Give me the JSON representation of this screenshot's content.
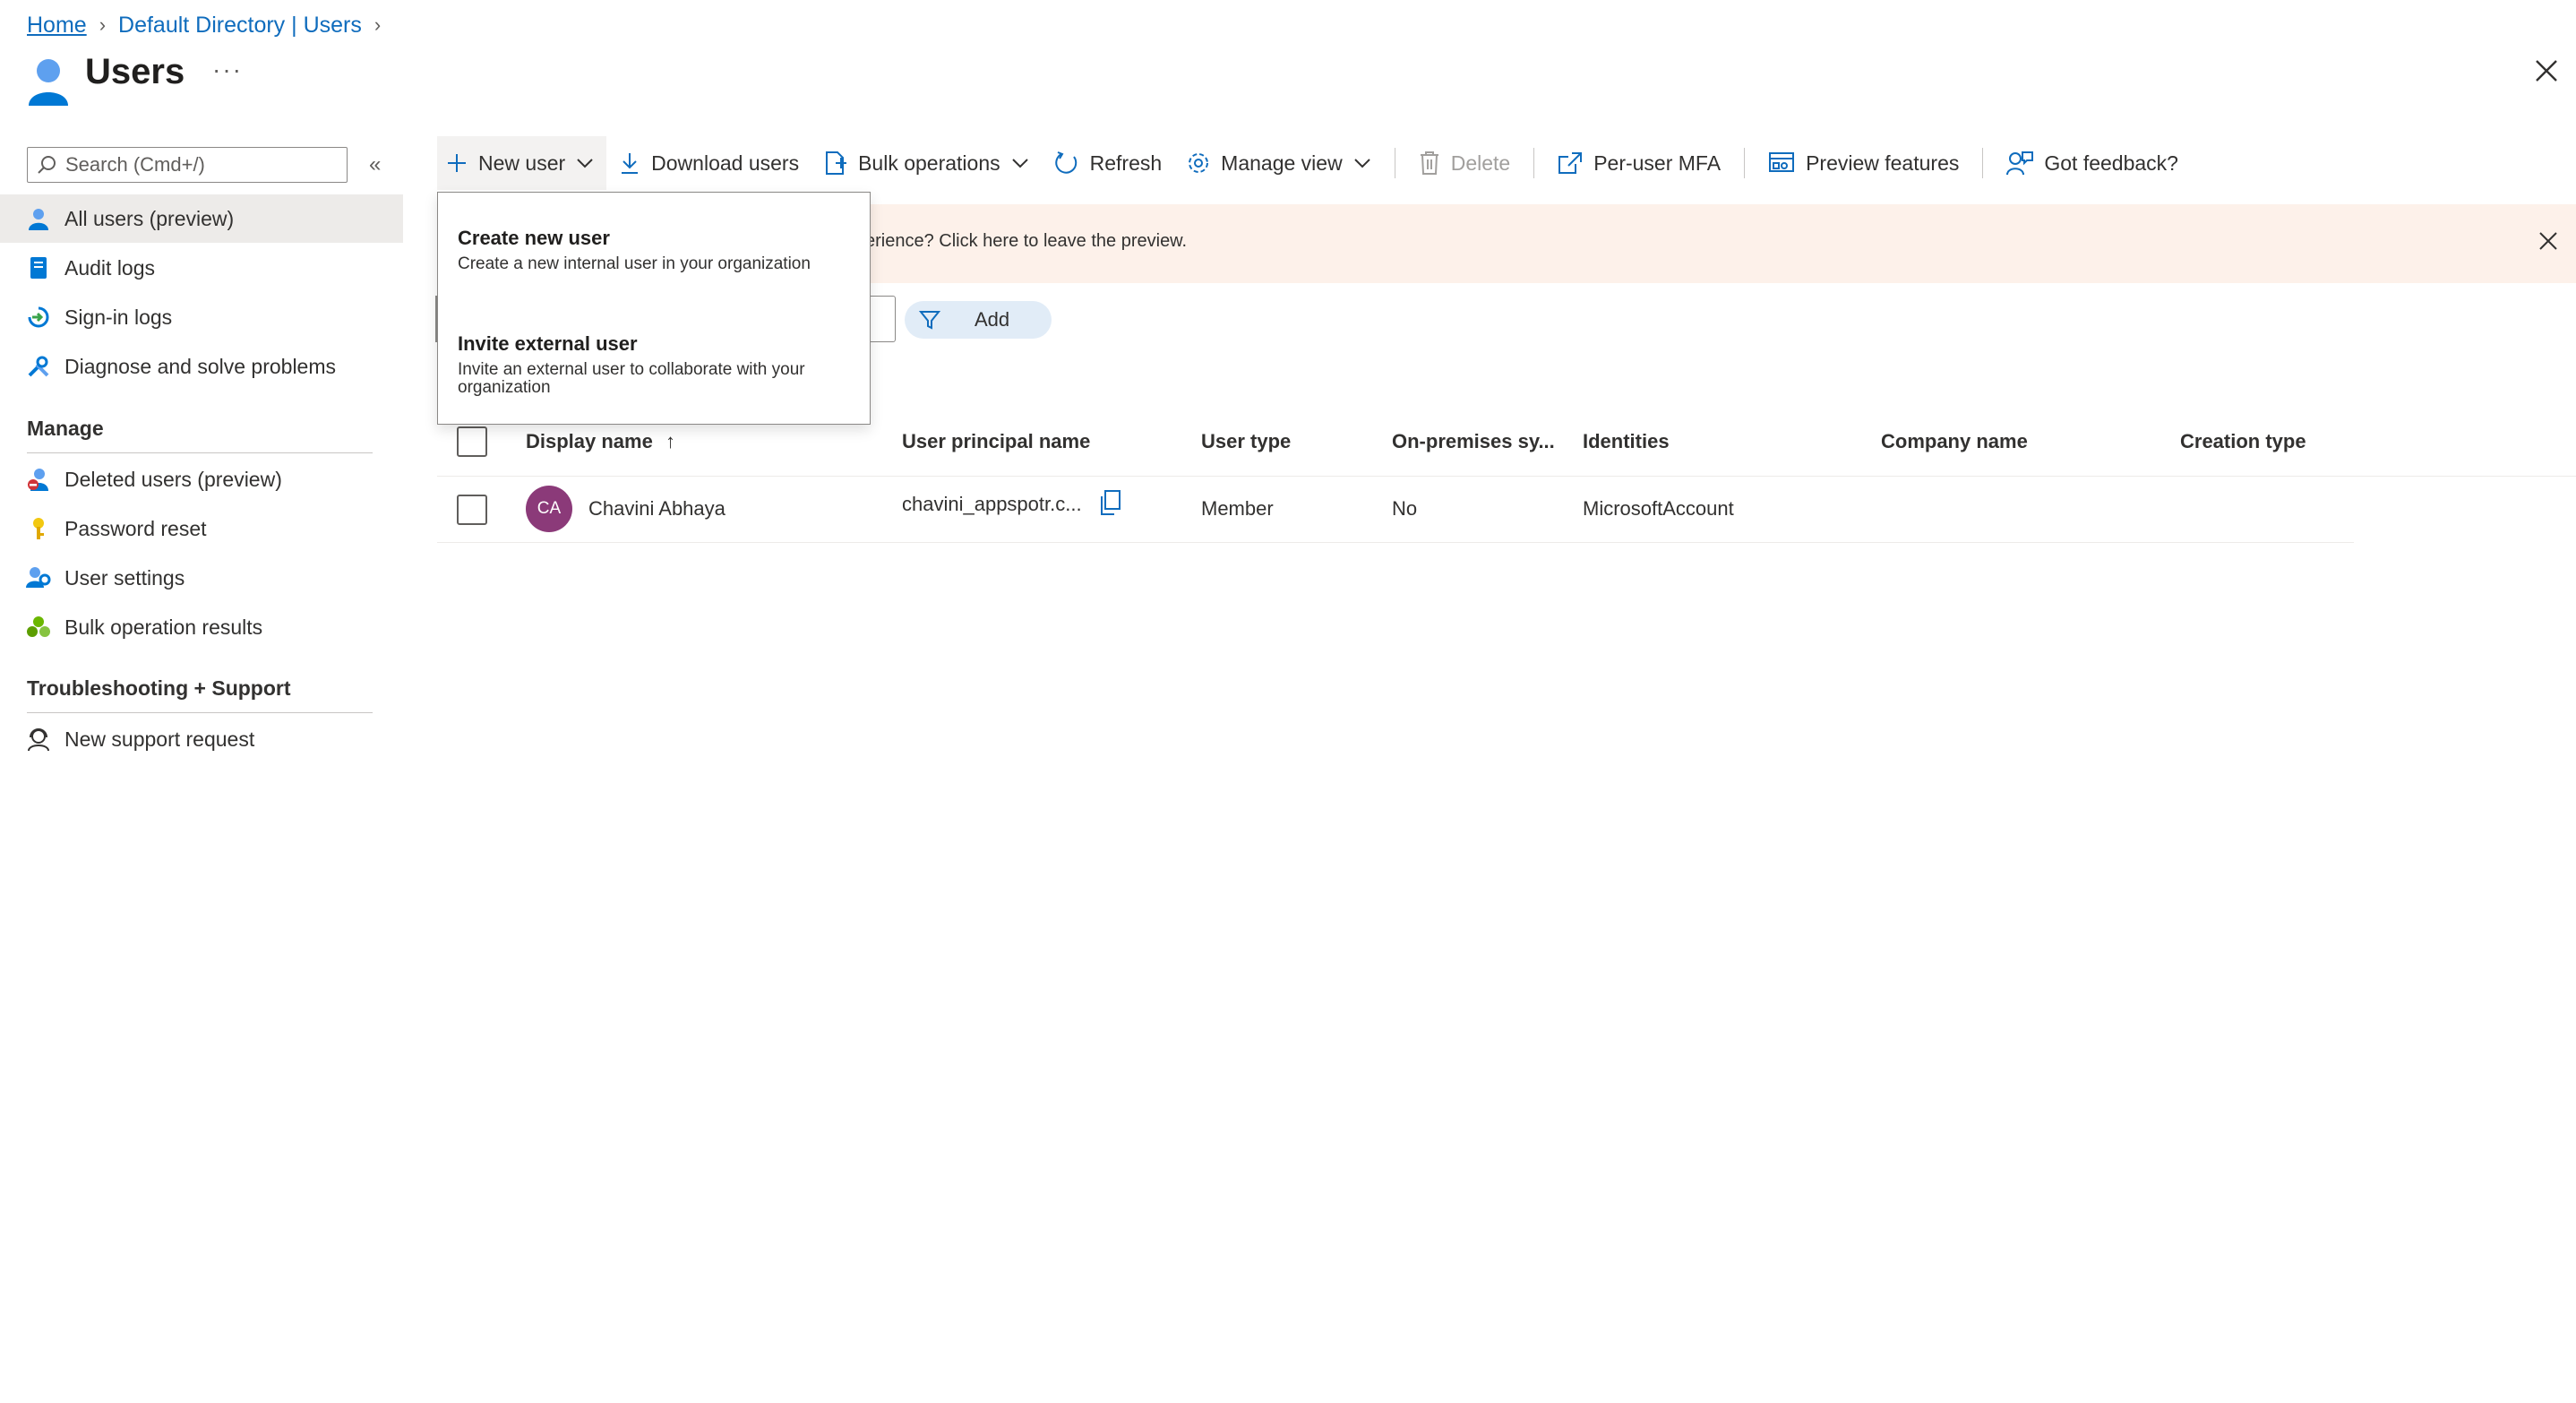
{
  "breadcrumb": {
    "home": "Home",
    "directory": "Default Directory | Users"
  },
  "header": {
    "title": "Users",
    "more": "···"
  },
  "sidebar": {
    "search_placeholder": "Search (Cmd+/)",
    "collapse": "«",
    "items": [
      {
        "label": "All users (preview)",
        "icon": "user-icon",
        "active": true
      },
      {
        "label": "Audit logs",
        "icon": "audit-log-icon"
      },
      {
        "label": "Sign-in logs",
        "icon": "sign-in-icon"
      },
      {
        "label": "Diagnose and solve problems",
        "icon": "wrench-icon"
      }
    ],
    "manage_heading": "Manage",
    "manage_items": [
      {
        "label": "Deleted users (preview)",
        "icon": "deleted-user-icon"
      },
      {
        "label": "Password reset",
        "icon": "key-icon"
      },
      {
        "label": "User settings",
        "icon": "user-settings-icon"
      },
      {
        "label": "Bulk operation results",
        "icon": "bulk-results-icon"
      }
    ],
    "support_heading": "Troubleshooting + Support",
    "support_items": [
      {
        "label": "New support request",
        "icon": "support-icon"
      }
    ]
  },
  "toolbar": {
    "new_user": "New user",
    "download_users": "Download users",
    "bulk_operations": "Bulk operations",
    "refresh": "Refresh",
    "manage_view": "Manage view",
    "delete": "Delete",
    "per_user_mfa": "Per-user MFA",
    "preview_features": "Preview features",
    "got_feedback": "Got feedback?"
  },
  "banner": {
    "text": "erience? Click here to leave the preview."
  },
  "filter": {
    "add_label": "Add"
  },
  "dropdown": {
    "create_title": "Create new user",
    "create_desc": "Create a new internal user in your organization",
    "invite_title": "Invite external user",
    "invite_desc": "Invite an external user to collaborate with your organization"
  },
  "table": {
    "columns": [
      "Display name",
      "User principal name",
      "User type",
      "On-premises sy...",
      "Identities",
      "Company name",
      "Creation type"
    ],
    "sort_indicator": "↑",
    "rows": [
      {
        "initials": "CA",
        "display_name": "Chavini Abhaya",
        "upn": "chavini_appspotr.c...",
        "user_type": "Member",
        "on_prem": "No",
        "identities": "MicrosoftAccount",
        "company": "",
        "creation_type": ""
      }
    ]
  },
  "colors": {
    "accent": "#0f6cbd",
    "banner": "#fdf1ea",
    "avatar": "#8b3a79",
    "active_nav": "#edebe9"
  }
}
